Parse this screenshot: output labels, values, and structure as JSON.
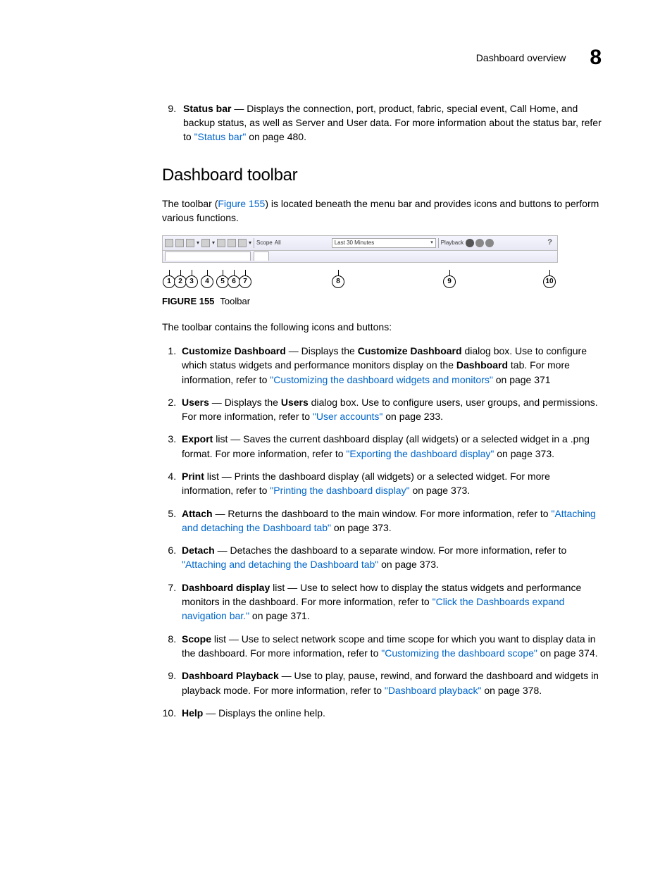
{
  "header": {
    "section": "Dashboard overview",
    "chapter": "8"
  },
  "item9": {
    "number": "9",
    "name": "Status bar",
    "desc_a": " — Displays the connection, port, product, fabric, special event, Call Home, and backup status, as well as Server and User data. For more information about the status bar, refer to ",
    "link": "\"Status bar\"",
    "tail": " on page 480."
  },
  "section": {
    "title": "Dashboard toolbar",
    "intro_a": "The toolbar (",
    "intro_link": "Figure 155",
    "intro_b": ") is located beneath the menu bar and provides icons and buttons to perform various functions.",
    "figure_label": "FIGURE 155",
    "figure_title": "Toolbar",
    "after_figure": "The toolbar contains the following icons and buttons:"
  },
  "toolbar": {
    "scope_label": "Scope",
    "scope_value": "All",
    "time_value": "Last 30 Minutes",
    "playback_label": "Playback",
    "callouts": [
      "1",
      "2",
      "3",
      "4",
      "5",
      "6",
      "7",
      "8",
      "9",
      "10"
    ]
  },
  "items": {
    "i1": {
      "name": "Customize Dashboard",
      "a": " — Displays the ",
      "b1": "Customize Dashboard",
      "c": " dialog box. Use to configure which status widgets and performance monitors display on the ",
      "b2": "Dashboard",
      "d": " tab. For more information, refer to ",
      "link": "\"Customizing the dashboard widgets and monitors\"",
      "tail": " on page 371"
    },
    "i2": {
      "name": "Users",
      "a": " — Displays the ",
      "b1": "Users",
      "c": " dialog box. Use to configure users, user groups, and permissions. For more information, refer to ",
      "link": "\"User accounts\"",
      "tail": " on page 233."
    },
    "i3": {
      "name": "Export",
      "suffix": " list",
      "a": " — Saves the current dashboard display (all widgets) or a selected widget in a .png format. For more information, refer to ",
      "link": "\"Exporting the dashboard display\"",
      "tail": " on page 373."
    },
    "i4": {
      "name": "Print",
      "suffix": " list",
      "a": " — Prints the dashboard display (all widgets) or a selected widget. For more information, refer to ",
      "link": "\"Printing the dashboard display\"",
      "tail": " on page 373."
    },
    "i5": {
      "name": "Attach",
      "a": " — Returns the dashboard to the main window. For more information, refer to ",
      "link": "\"Attaching and detaching the Dashboard tab\"",
      "tail": " on page 373."
    },
    "i6": {
      "name": "Detach",
      "a": " — Detaches the dashboard to a separate window. For more information, refer to ",
      "link": "\"Attaching and detaching the Dashboard tab\"",
      "tail": " on page 373."
    },
    "i7": {
      "name": "Dashboard display",
      "suffix": " list",
      "a": " — Use to select how to display the status widgets and performance monitors in the dashboard. For more information, refer to ",
      "link": "\"Click the Dashboards expand navigation bar.\"",
      "tail": " on page 371."
    },
    "i8": {
      "name": "Scope",
      "suffix": " list",
      "a": " — Use to select network scope and time scope for which you want to display data in the dashboard. For more information, refer to ",
      "link": "\"Customizing the dashboard scope\"",
      "tail": " on page 374."
    },
    "i9": {
      "name": "Dashboard Playback",
      "a": " — Use to play, pause, rewind, and forward the dashboard and widgets in playback mode. For more information, refer to ",
      "link": "\"Dashboard playback\"",
      "tail": " on page 378."
    },
    "i10": {
      "name": "Help",
      "a": " — Displays the online help."
    }
  }
}
